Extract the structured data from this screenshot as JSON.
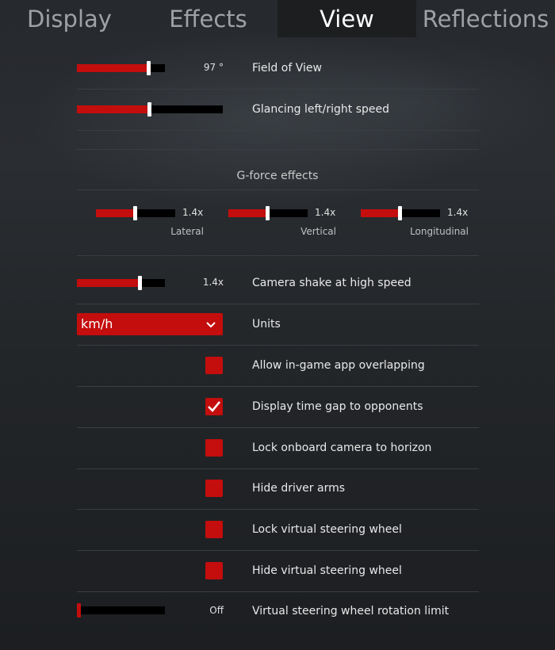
{
  "tabs": [
    {
      "label": "Display"
    },
    {
      "label": "Effects"
    },
    {
      "label": "View",
      "active": true
    },
    {
      "label": "Reflections"
    }
  ],
  "field_of_view": {
    "label": "Field of View",
    "value": "97 °",
    "level": 0.82
  },
  "glancing_speed": {
    "label": "Glancing left/right speed",
    "level": 0.5
  },
  "gforce": {
    "title": "G-force effects",
    "lateral": {
      "label": "Lateral",
      "value": "1.4x",
      "level": 0.5
    },
    "vertical": {
      "label": "Vertical",
      "value": "1.4x",
      "level": 0.5
    },
    "longitudinal": {
      "label": "Longitudinal",
      "value": "1.4x",
      "level": 0.5
    }
  },
  "camera_shake": {
    "label": "Camera shake at high speed",
    "value": "1.4x",
    "level": 0.72
  },
  "units": {
    "label": "Units",
    "selected": "km/h"
  },
  "checkboxes": [
    {
      "label": "Allow in-game app overlapping",
      "checked": false
    },
    {
      "label": "Display time gap to opponents",
      "checked": true
    },
    {
      "label": "Lock onboard camera to horizon",
      "checked": false
    },
    {
      "label": "Hide driver arms",
      "checked": false
    },
    {
      "label": "Lock virtual steering wheel",
      "checked": false
    },
    {
      "label": "Hide virtual steering wheel",
      "checked": false
    }
  ],
  "steering_limit": {
    "label": "Virtual steering wheel rotation limit",
    "value": "Off",
    "level": 0.0
  },
  "colors": {
    "accent": "#c40d0d",
    "track": "#000000",
    "text": "#e9e9e9"
  }
}
